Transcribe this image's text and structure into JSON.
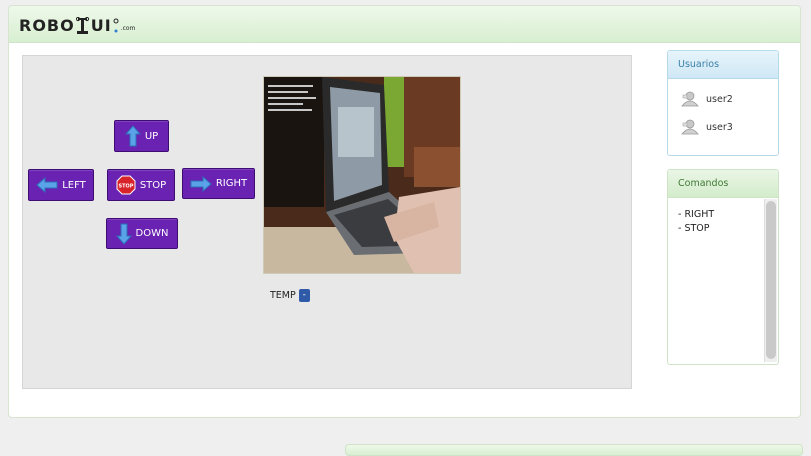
{
  "header": {
    "logo_text_1": "ROBO",
    "logo_text_2": "UI",
    "logo_suffix": ".com"
  },
  "controls": {
    "up": "UP",
    "down": "DOWN",
    "left": "LEFT",
    "right": "RIGHT",
    "stop": "STOP",
    "stop_sign": "STOP"
  },
  "temp": {
    "label": "TEMP",
    "value": "-"
  },
  "users_panel": {
    "title": "Usuarios",
    "users": [
      {
        "name": "user2",
        "icon": "user-icon"
      },
      {
        "name": "user3",
        "icon": "user-icon"
      }
    ]
  },
  "commands_panel": {
    "title": "Comandos",
    "commands": [
      "- RIGHT",
      "- STOP"
    ]
  },
  "colors": {
    "button_bg": "#6a22b3",
    "arrow_blue": "#4a90e2",
    "header_green": "#d8efd1",
    "users_header_blue": "#cfe8f5",
    "temp_badge": "#2f5aa8"
  }
}
